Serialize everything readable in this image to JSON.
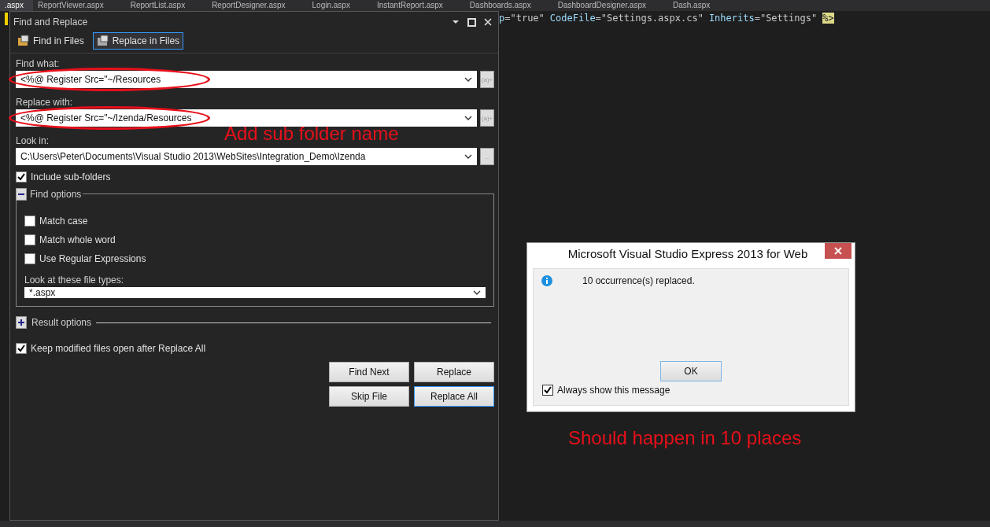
{
  "editor_tabs": [
    {
      "label": ".aspx",
      "selected": true
    },
    {
      "label": "ReportViewer.aspx",
      "selected": false
    },
    {
      "label": "ReportList.aspx",
      "selected": false
    },
    {
      "label": "ReportDesigner.aspx",
      "selected": false
    },
    {
      "label": "Login.aspx",
      "selected": false
    },
    {
      "label": "InstantReport.aspx",
      "selected": false
    },
    {
      "label": "Dashboards.aspx",
      "selected": false
    },
    {
      "label": "DashboardDesigner.aspx",
      "selected": false
    },
    {
      "label": "Dash.aspx",
      "selected": false
    }
  ],
  "code_line": [
    {
      "kind": "attr",
      "text": "p"
    },
    {
      "kind": "value",
      "text": "=\"true\""
    },
    {
      "kind": "attr",
      "text": "CodeFile"
    },
    {
      "kind": "value",
      "text": "=\"Settings.aspx.cs\""
    },
    {
      "kind": "attr",
      "text": "Inherits"
    },
    {
      "kind": "value",
      "text": "=\"Settings\""
    },
    {
      "kind": "delimiter",
      "text": "%>"
    }
  ],
  "panel": {
    "title": "Find and Replace",
    "tabs": [
      {
        "label": "Find in Files",
        "selected": false
      },
      {
        "label": "Replace in Files",
        "selected": true
      }
    ],
    "fields": [
      {
        "label": "Find what:",
        "value": "<%@ Register Src=\"~/Resources",
        "highlighted": true,
        "side_button": "(a)+"
      },
      {
        "label": "Replace with:",
        "value": "<%@ Register Src=\"~/Izenda/Resources",
        "highlighted": true,
        "side_button": "(a)+"
      },
      {
        "label": "Look in:",
        "value": "C:\\Users\\Peter\\Documents\\Visual Studio 2013\\WebSites\\Integration_Demo\\Izenda",
        "highlighted": false,
        "side_button": "..."
      }
    ],
    "include_subfolders": {
      "label": "Include sub-folders",
      "checked": true
    },
    "find_options": {
      "label": "Find options",
      "expanded": true,
      "options": [
        {
          "label": "Match case",
          "checked": false
        },
        {
          "label": "Match whole word",
          "checked": false
        },
        {
          "label": "Use Regular Expressions",
          "checked": false
        }
      ],
      "file_types": {
        "label": "Look at these file types:",
        "value": "*.aspx"
      }
    },
    "result_options": {
      "label": "Result options",
      "expanded": false
    },
    "keep_open": {
      "label": "Keep modified files open after Replace All",
      "checked": true
    },
    "buttons": [
      {
        "label": "Find Next",
        "focused": false
      },
      {
        "label": "Replace",
        "focused": false
      },
      {
        "label": "Skip File",
        "focused": false
      },
      {
        "label": "Replace All",
        "focused": true
      }
    ]
  },
  "dialog": {
    "title": "Microsoft Visual Studio Express 2013 for Web",
    "message": "10 occurrence(s) replaced.",
    "button": "OK",
    "always_show": {
      "label": "Always show this message",
      "checked": true
    }
  },
  "annotations": [
    {
      "kind": "field-note",
      "text": "Add sub folder name"
    },
    {
      "kind": "dialog-note",
      "text": "Should happen in 10 places"
    }
  ]
}
